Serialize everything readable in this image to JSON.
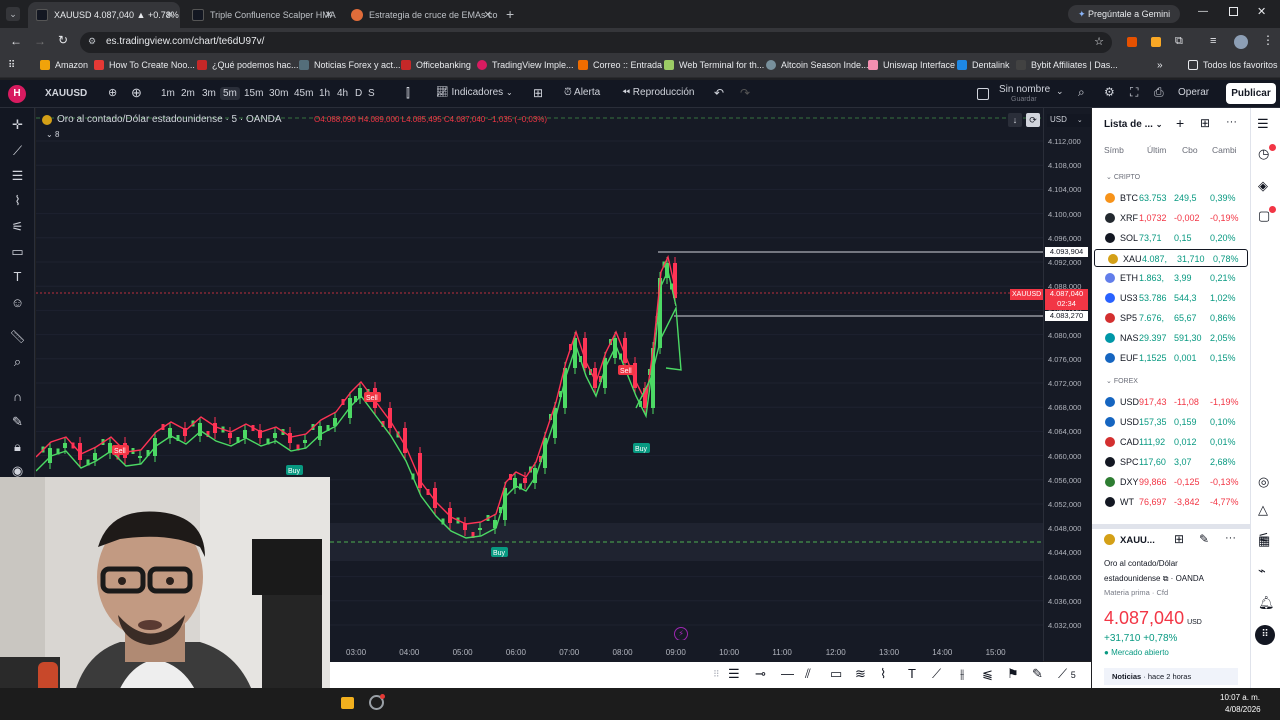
{
  "browser": {
    "tabs": [
      {
        "title": "XAUUSD 4.087,040 ▲ +0.78% S",
        "active": true
      },
      {
        "title": "Triple Confluence Scalper HMA"
      },
      {
        "title": "Estrategia de cruce de EMAs co"
      }
    ],
    "gemini_label": "Pregúntale a Gemini",
    "url": "es.tradingview.com/chart/te6dU97v/",
    "bookmarks": [
      "Amazon",
      "How To Create Noo...",
      "¿Qué podemos hac...",
      "Noticias Forex y act...",
      "Officebanking",
      "TradingView Imple...",
      "Correo :: Entrada",
      "Web Terminal for th...",
      "Altcoin Season Inde...",
      "Uniswap Interface",
      "Dentalink",
      "Bybit Affiliates | Das..."
    ],
    "all_favorites": "Todos los favoritos"
  },
  "toolbar": {
    "symbol": "XAUUSD",
    "timeframes": [
      "1m",
      "2m",
      "3m",
      "5m",
      "15m",
      "30m",
      "45m",
      "1h",
      "4h",
      "D",
      "S"
    ],
    "indicators": "Indicadores",
    "alert": "Alerta",
    "replay": "Reproducción",
    "layout_name": "Sin nombre",
    "save": "Guardar",
    "trade": "Operar",
    "publish": "Publicar"
  },
  "chart": {
    "title": "Oro al contado/Dólar estadounidense · 5 · OANDA",
    "ohlc": "O4.088,090  H4.089,000  L4.085,495  C4.087,040  −1,035 (−0,03%)",
    "currency": "USD",
    "indicator_count": "8",
    "price_labels": [
      "4.112,000",
      "4.108,000",
      "4.104,000",
      "4.100,000",
      "4.096,000",
      "4.092,000",
      "4.088,000",
      "4.084,000",
      "4.080,000",
      "4.076,000",
      "4.072,000",
      "4.068,000",
      "4.064,000",
      "4.060,000",
      "4.056,000",
      "4.052,000",
      "4.048,000",
      "4.044,000",
      "4.040,000",
      "4.036,000",
      "4.032,000"
    ],
    "high_marker": "4.093,904",
    "current_symbol": "XAUUSD",
    "current_price": "4.087,040",
    "countdown": "02:34",
    "low_marker": "4.083,270",
    "time_labels": [
      "03:00",
      "04:00",
      "05:00",
      "06:00",
      "07:00",
      "08:00",
      "09:00",
      "10:00",
      "11:00",
      "12:00",
      "13:00",
      "14:00",
      "15:00"
    ],
    "signals": [
      "Sell",
      "Sell",
      "Sell",
      "Buy",
      "Buy",
      "Buy"
    ],
    "bottom_tool_count": "5"
  },
  "watchlist": {
    "title": "Lista de ...",
    "columns": [
      "Símb",
      "Últim",
      "Cbo",
      "Cambi"
    ],
    "section_crypto": "CRIPTO",
    "section_forex": "FOREX",
    "crypto": [
      {
        "sym": "BTC",
        "last": "63.753",
        "chg": "249,5",
        "pct": "0,39%",
        "color": "#f7931a",
        "pos": true
      },
      {
        "sym": "XRF",
        "last": "1,0732",
        "chg": "-0,002",
        "pct": "-0,19%",
        "color": "#23292f",
        "pos": false
      },
      {
        "sym": "SOL",
        "last": "73,71",
        "chg": "0,15",
        "pct": "0,20%",
        "color": "#131722",
        "pos": true
      },
      {
        "sym": "XAU",
        "last": "4.087,",
        "chg": "31,710",
        "pct": "0,78%",
        "color": "#d4a017",
        "pos": true,
        "selected": true
      },
      {
        "sym": "ETH",
        "last": "1.863,",
        "chg": "3,99",
        "pct": "0,21%",
        "color": "#627eea",
        "pos": true
      },
      {
        "sym": "US3",
        "last": "53.786",
        "chg": "544,3",
        "pct": "1,02%",
        "color": "#2962ff",
        "pos": true
      },
      {
        "sym": "SP5",
        "last": "7.676,",
        "chg": "65,67",
        "pct": "0,86%",
        "color": "#d32f2f",
        "pos": true
      },
      {
        "sym": "NAS",
        "last": "29.397",
        "chg": "591,30",
        "pct": "2,05%",
        "color": "#0097a7",
        "pos": true
      },
      {
        "sym": "EUF",
        "last": "1,1525",
        "chg": "0,001",
        "pct": "0,15%",
        "color": "#1565c0",
        "pos": true
      }
    ],
    "forex": [
      {
        "sym": "USD",
        "last": "917,43",
        "chg": "-11,08",
        "pct": "-1,19%",
        "color": "#1565c0",
        "pos": false
      },
      {
        "sym": "USD",
        "last": "157,35",
        "chg": "0,159",
        "pct": "0,10%",
        "color": "#1565c0",
        "pos": true
      },
      {
        "sym": "CAD",
        "last": "111,92",
        "chg": "0,012",
        "pct": "0,01%",
        "color": "#d32f2f",
        "pos": true
      },
      {
        "sym": "SPC",
        "last": "117,60",
        "chg": "3,07",
        "pct": "2,68%",
        "color": "#131722",
        "pos": true
      },
      {
        "sym": "DXY",
        "last": "99,866",
        "chg": "-0,125",
        "pct": "-0,13%",
        "color": "#2e7d32",
        "pos": false
      },
      {
        "sym": "WT",
        "last": "76,697",
        "chg": "-3,842",
        "pct": "-4,77%",
        "color": "#131722",
        "pos": false
      }
    ]
  },
  "details": {
    "symbol": "XAUU...",
    "name_line1": "Oro al contado/Dólar",
    "name_line2": "estadounidense",
    "exchange": "OANDA",
    "category": "Materia prima · Cfd",
    "price": "4.087,040",
    "currency": "USD",
    "change": "+31,710",
    "change_pct": "+0,78%",
    "market_status": "Mercado abierto",
    "news_label": "Noticias",
    "news_time": "hace 2 horas"
  },
  "taskbar": {
    "time": "10:07 a. m.",
    "date": "4/08/2026"
  },
  "colors": {
    "up": "#089981",
    "down": "#f23645",
    "accent": "#2962ff",
    "green_line": "#4cd964",
    "red_line": "#ff3355"
  }
}
